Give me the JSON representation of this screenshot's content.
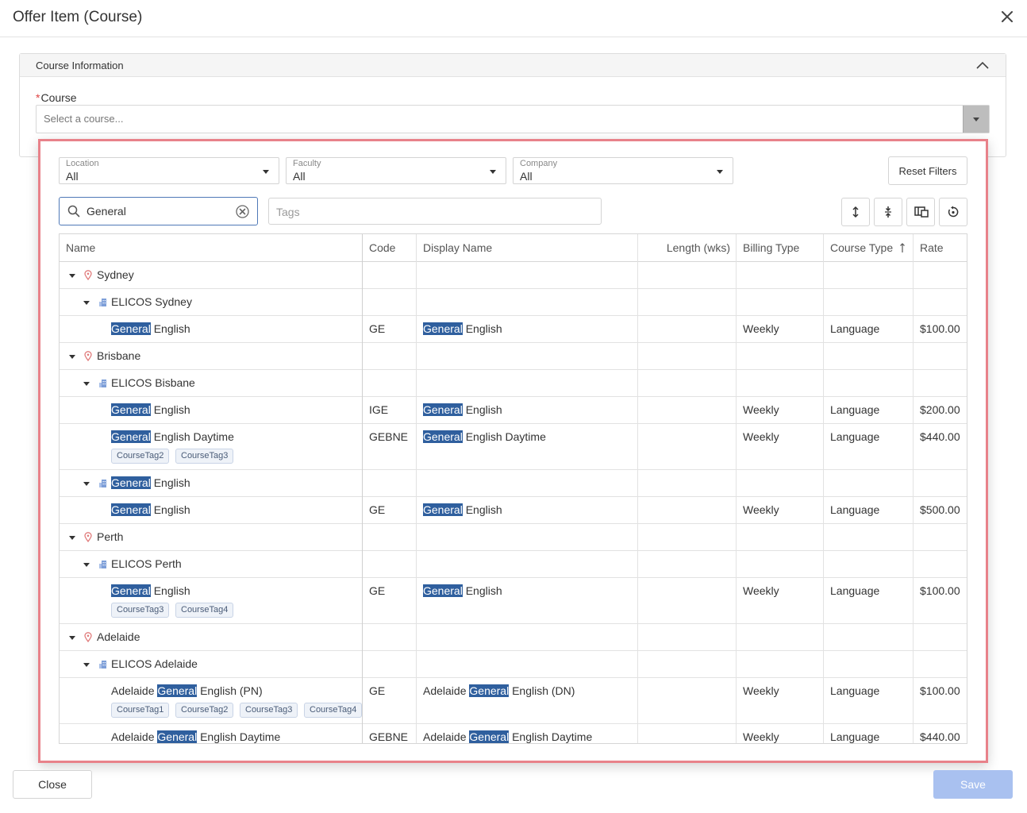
{
  "dialog": {
    "title": "Offer Item (Course)"
  },
  "course_info": {
    "section_title": "Course Information",
    "course_label": "Course",
    "course_placeholder": "Select a course..."
  },
  "filters": {
    "location": {
      "label": "Location",
      "value": "All"
    },
    "faculty": {
      "label": "Faculty",
      "value": "All"
    },
    "company": {
      "label": "Company",
      "value": "All"
    },
    "reset_label": "Reset Filters"
  },
  "search": {
    "value": "General",
    "tags_placeholder": "Tags"
  },
  "toolbar_icons": [
    "expand-all-icon",
    "collapse-all-icon",
    "column-chooser-icon",
    "reset-layout-icon"
  ],
  "grid": {
    "columns": [
      "Name",
      "Code",
      "Display Name",
      "Length (wks)",
      "Billing Type",
      "Course Type",
      "Rate"
    ],
    "sort": {
      "column": "Course Type",
      "direction": "asc"
    },
    "rows": [
      {
        "level": 0,
        "type": "location",
        "name": "Sydney"
      },
      {
        "level": 1,
        "type": "group",
        "name": "ELICOS Sydney"
      },
      {
        "level": 2,
        "type": "course",
        "name_pre": "",
        "name_hl": "General",
        "name_post": " English",
        "code": "GE",
        "disp_pre": "",
        "disp_hl": "General",
        "disp_post": " English",
        "length": "",
        "billing": "Weekly",
        "ctype": "Language",
        "rate": "$100.00",
        "tags": []
      },
      {
        "level": 0,
        "type": "location",
        "name": "Brisbane"
      },
      {
        "level": 1,
        "type": "group",
        "name": "ELICOS Bisbane"
      },
      {
        "level": 2,
        "type": "course",
        "name_pre": "",
        "name_hl": "General",
        "name_post": " English",
        "code": "IGE",
        "disp_pre": "",
        "disp_hl": "General",
        "disp_post": " English",
        "length": "",
        "billing": "Weekly",
        "ctype": "Language",
        "rate": "$200.00",
        "tags": []
      },
      {
        "level": 2,
        "type": "course",
        "name_pre": "",
        "name_hl": "General",
        "name_post": " English Daytime",
        "code": "GEBNE",
        "disp_pre": "",
        "disp_hl": "General",
        "disp_post": " English Daytime",
        "length": "",
        "billing": "Weekly",
        "ctype": "Language",
        "rate": "$440.00",
        "tags": [
          "CourseTag2",
          "CourseTag3"
        ]
      },
      {
        "level": 1,
        "type": "group",
        "name_pre": "",
        "name_hl": "General",
        "name_post": " English"
      },
      {
        "level": 2,
        "type": "course",
        "name_pre": "",
        "name_hl": "General",
        "name_post": " English",
        "code": "GE",
        "disp_pre": "",
        "disp_hl": "General",
        "disp_post": " English",
        "length": "",
        "billing": "Weekly",
        "ctype": "Language",
        "rate": "$500.00",
        "tags": []
      },
      {
        "level": 0,
        "type": "location",
        "name": "Perth"
      },
      {
        "level": 1,
        "type": "group",
        "name": "ELICOS Perth"
      },
      {
        "level": 2,
        "type": "course",
        "name_pre": "",
        "name_hl": "General",
        "name_post": " English",
        "code": "GE",
        "disp_pre": "",
        "disp_hl": "General",
        "disp_post": " English",
        "length": "",
        "billing": "Weekly",
        "ctype": "Language",
        "rate": "$100.00",
        "tags": [
          "CourseTag3",
          "CourseTag4"
        ]
      },
      {
        "level": 0,
        "type": "location",
        "name": "Adelaide"
      },
      {
        "level": 1,
        "type": "group",
        "name": "ELICOS Adelaide"
      },
      {
        "level": 2,
        "type": "course",
        "name_pre": "Adelaide ",
        "name_hl": "General",
        "name_post": " English (PN)",
        "code": "GE",
        "disp_pre": "Adelaide ",
        "disp_hl": "General",
        "disp_post": " English (DN)",
        "length": "",
        "billing": "Weekly",
        "ctype": "Language",
        "rate": "$100.00",
        "tags": [
          "CourseTag1",
          "CourseTag2",
          "CourseTag3",
          "CourseTag4"
        ]
      },
      {
        "level": 2,
        "type": "course",
        "name_pre": "Adelaide ",
        "name_hl": "General",
        "name_post": " English Daytime",
        "code": "GEBNE",
        "disp_pre": "Adelaide ",
        "disp_hl": "General",
        "disp_post": " English Daytime",
        "length": "",
        "billing": "Weekly",
        "ctype": "Language",
        "rate": "$440.00",
        "tags": []
      }
    ]
  },
  "footer": {
    "close_label": "Close",
    "save_label": "Save"
  }
}
